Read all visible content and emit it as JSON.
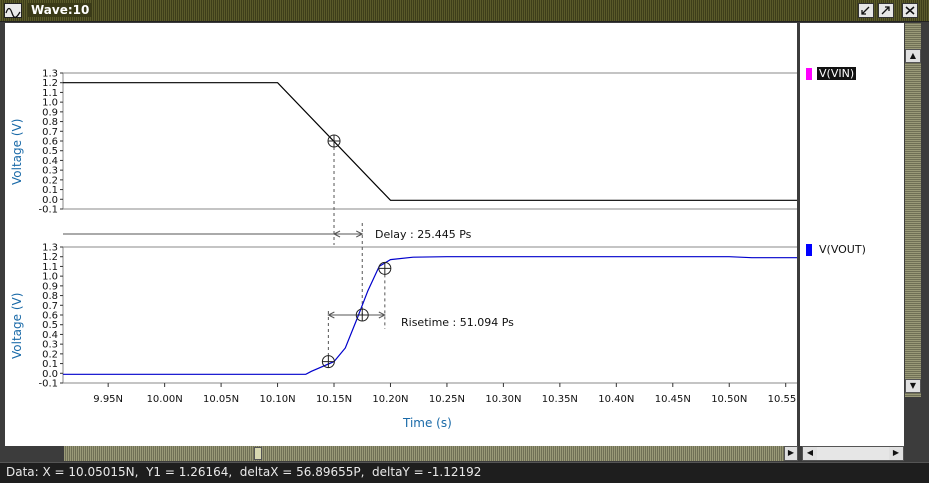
{
  "window": {
    "title": "Wave:10"
  },
  "legend": [
    {
      "label": "V(VIN)",
      "color": "#ff00ff",
      "selected": true
    },
    {
      "label": "V(VOUT)",
      "color": "#0000ff",
      "selected": false
    }
  ],
  "status": {
    "text": "Data: X = 10.05015N,  Y1 = 1.26164,  deltaX = 56.89655P,  deltaY = -1.12192"
  },
  "chart_data": [
    {
      "type": "line",
      "series": [
        {
          "name": "V(VIN)",
          "color": "#000000",
          "x": [
            9.91,
            10.1,
            10.2,
            10.56
          ],
          "y": [
            1.2,
            1.2,
            -0.01,
            -0.01
          ]
        }
      ],
      "ylabel": "Voltage (V)",
      "ylim": [
        -0.1,
        1.3
      ],
      "yticks": [
        "1.3",
        "1.2",
        "1.1",
        "1.0",
        "0.9",
        "0.8",
        "0.7",
        "0.6",
        "0.5",
        "0.4",
        "0.3",
        "0.2",
        "0.1",
        "0.0",
        "-0.1"
      ],
      "markers": [
        {
          "x": 10.15,
          "y": 0.6
        }
      ]
    },
    {
      "type": "line",
      "series": [
        {
          "name": "V(VOUT)",
          "color": "#0000cc",
          "x": [
            9.91,
            10.1,
            10.125,
            10.13,
            10.15,
            10.16,
            10.17,
            10.18,
            10.19,
            10.2,
            10.22,
            10.25,
            10.3,
            10.4,
            10.5,
            10.52,
            10.56
          ],
          "y": [
            -0.01,
            -0.01,
            -0.01,
            0.02,
            0.12,
            0.26,
            0.55,
            0.85,
            1.1,
            1.17,
            1.195,
            1.2,
            1.2,
            1.2,
            1.2,
            1.19,
            1.19
          ]
        }
      ],
      "ylabel": "Voltage (V)",
      "xlabel": "Time (s)",
      "ylim": [
        -0.1,
        1.3
      ],
      "xlim": [
        9.91,
        10.56
      ],
      "yticks": [
        "1.3",
        "1.2",
        "1.1",
        "1.0",
        "0.9",
        "0.8",
        "0.7",
        "0.6",
        "0.5",
        "0.4",
        "0.3",
        "0.2",
        "0.1",
        "0.0",
        "-0.1"
      ],
      "xticks": [
        {
          "v": 9.95,
          "label": "9.95N"
        },
        {
          "v": 10.0,
          "label": "10.00N"
        },
        {
          "v": 10.05,
          "label": "10.05N"
        },
        {
          "v": 10.1,
          "label": "10.10N"
        },
        {
          "v": 10.15,
          "label": "10.15N"
        },
        {
          "v": 10.2,
          "label": "10.20N"
        },
        {
          "v": 10.25,
          "label": "10.25N"
        },
        {
          "v": 10.3,
          "label": "10.30N"
        },
        {
          "v": 10.35,
          "label": "10.35N"
        },
        {
          "v": 10.4,
          "label": "10.40N"
        },
        {
          "v": 10.45,
          "label": "10.45N"
        },
        {
          "v": 10.5,
          "label": "10.50N"
        },
        {
          "v": 10.55,
          "label": "10.55N"
        }
      ],
      "markers": [
        {
          "x": 10.145,
          "y": 0.12
        },
        {
          "x": 10.175,
          "y": 0.6
        },
        {
          "x": 10.195,
          "y": 1.08
        }
      ]
    }
  ],
  "measurements": {
    "delay": {
      "label": "Delay : 25.445 Ps",
      "x1": 10.15,
      "x2": 10.175
    },
    "risetime": {
      "label": "Risetime : 51.094 Ps",
      "x1": 10.145,
      "x2": 10.195
    }
  }
}
